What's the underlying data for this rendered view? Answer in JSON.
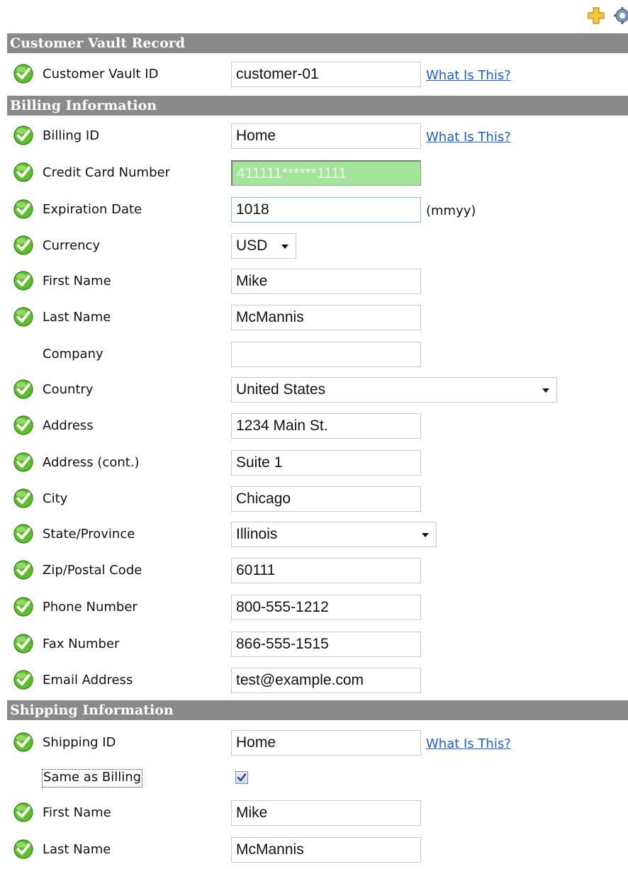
{
  "icons": {
    "toolbar": [
      "plus-icon",
      "gear-icon"
    ],
    "valid": "check-icon"
  },
  "colors": {
    "header_bg": "#8a8a8a",
    "link": "#1a5fd6",
    "masked_field": "#a4e39a",
    "valid_green": "#5fbf2a"
  },
  "sections": {
    "vault": "Customer Vault Record",
    "billing": "Billing Information",
    "shipping": "Shipping Information"
  },
  "links": {
    "what_is_this": "What Is This?"
  },
  "vault": {
    "id_label": "Customer Vault ID",
    "id_value": "customer-01"
  },
  "billing": {
    "billing_id_label": "Billing ID",
    "billing_id_value": "Home",
    "card_label": "Credit Card Number",
    "card_value": "411111******1111",
    "exp_label": "Expiration Date",
    "exp_value": "1018",
    "exp_hint": "(mmyy)",
    "currency_label": "Currency",
    "currency_value": "USD",
    "first_name_label": "First Name",
    "first_name_value": "Mike",
    "last_name_label": "Last Name",
    "last_name_value": "McMannis",
    "company_label": "Company",
    "company_value": "",
    "country_label": "Country",
    "country_value": "United States",
    "address_label": "Address",
    "address_value": "1234 Main St.",
    "address2_label": "Address (cont.)",
    "address2_value": "Suite 1",
    "city_label": "City",
    "city_value": "Chicago",
    "state_label": "State/Province",
    "state_value": "Illinois",
    "zip_label": "Zip/Postal Code",
    "zip_value": "60111",
    "phone_label": "Phone Number",
    "phone_value": "800-555-1212",
    "fax_label": "Fax Number",
    "fax_value": "866-555-1515",
    "email_label": "Email Address",
    "email_value": "test@example.com"
  },
  "shipping": {
    "shipping_id_label": "Shipping ID",
    "shipping_id_value": "Home",
    "same_as_billing_label": "Same as Billing",
    "same_as_billing_checked": true,
    "first_name_label": "First Name",
    "first_name_value": "Mike",
    "last_name_label": "Last Name",
    "last_name_value": "McMannis"
  }
}
